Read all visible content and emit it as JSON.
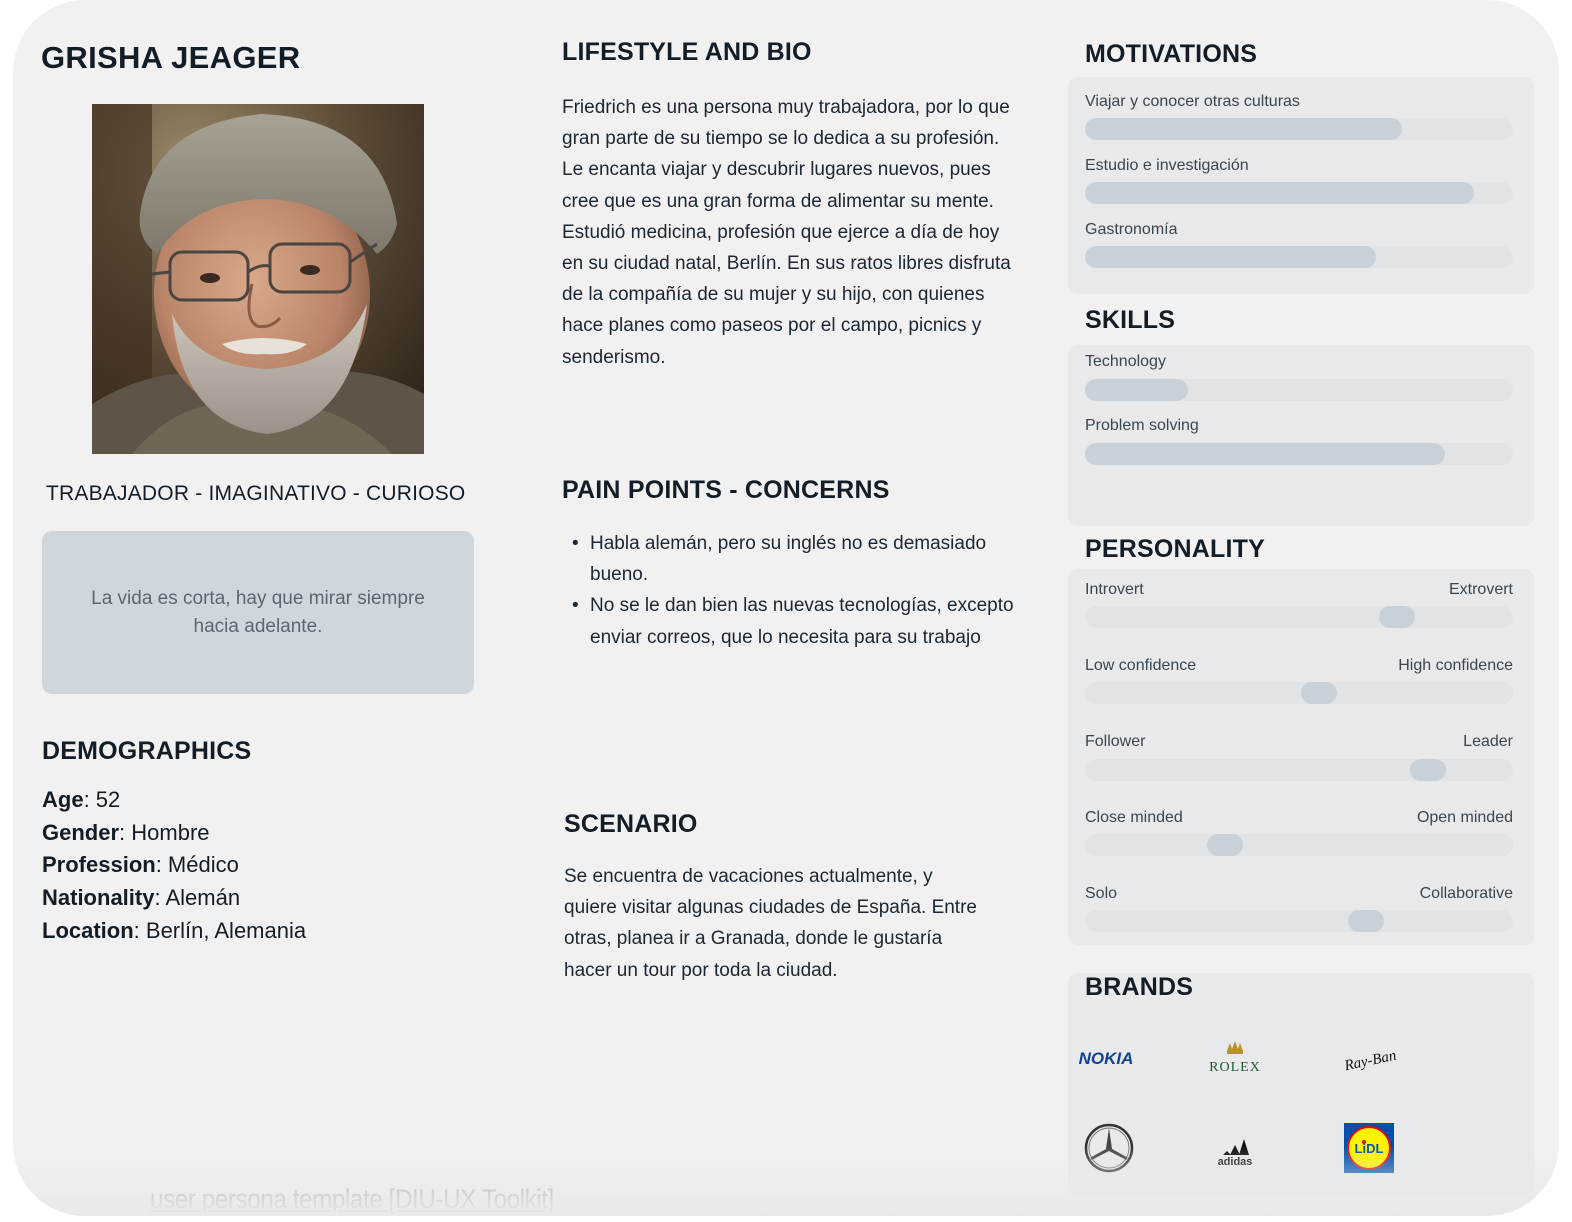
{
  "persona": {
    "name": "GRISHA JEAGER",
    "traits": "TRABAJADOR - IMAGINATIVO - CURIOSO",
    "quote": "La vida es corta, hay que mirar siempre hacia adelante."
  },
  "demographics": {
    "heading": "DEMOGRAPHICS",
    "items": [
      {
        "key": "Age",
        "value": ": 52"
      },
      {
        "key": "Gender",
        "value": ": Hombre"
      },
      {
        "key": "Profession",
        "value": ": Médico"
      },
      {
        "key": "Nationality",
        "value": ": Alemán"
      },
      {
        "key": "Location",
        "value": ": Berlín, Alemania"
      }
    ]
  },
  "bio": {
    "heading": "LIFESTYLE AND BIO",
    "lines": [
      "Friedrich es una persona muy trabajadora, por lo que",
      "gran parte de su tiempo se lo dedica a su profesión.",
      "Le encanta viajar y descubrir lugares nuevos, pues",
      "cree que es una gran forma de alimentar su mente.",
      "Estudió medicina, profesión que ejerce a día de hoy",
      "en su ciudad natal, Berlín. En sus ratos libres disfruta",
      "de la compañía de su mujer y su hijo, con quienes",
      "hace planes como paseos por el campo, picnics y",
      "senderismo."
    ]
  },
  "pains": {
    "heading": "PAIN POINTS - CONCERNS",
    "items": [
      "Habla alemán, pero su inglés no es demasiado bueno.",
      "No se le dan bien las nuevas tecnologías, excepto enviar correos, que lo necesita para su trabajo"
    ]
  },
  "scenario": {
    "heading": "SCENARIO",
    "lines": [
      "Se encuentra de vacaciones actualmente, y",
      "quiere visitar algunas ciudades de España. Entre",
      "otras, planea ir a Granada, donde le gustaría",
      "hacer un tour por toda la ciudad."
    ]
  },
  "motivations": {
    "heading": "MOTIVATIONS",
    "items": [
      {
        "label": "Viajar y conocer otras culturas",
        "level": 0.74
      },
      {
        "label": "Estudio e investigación",
        "level": 0.91
      },
      {
        "label": "Gastronomía",
        "level": 0.68
      }
    ]
  },
  "skills": {
    "heading": "SKILLS",
    "items": [
      {
        "label": "Technology",
        "level": 0.24
      },
      {
        "label": "Problem solving",
        "level": 0.84
      }
    ]
  },
  "personality": {
    "heading": "PERSONALITY",
    "items": [
      {
        "left": "Introvert",
        "right": "Extrovert",
        "position": 0.75
      },
      {
        "left": "Low confidence",
        "right": "High confidence",
        "position": 0.55
      },
      {
        "left": "Follower",
        "right": "Leader",
        "position": 0.83
      },
      {
        "left": "Close minded",
        "right": "Open minded",
        "position": 0.31
      },
      {
        "left": "Solo",
        "right": "Collaborative",
        "position": 0.67
      }
    ]
  },
  "brands": {
    "heading": "BRANDS",
    "logos": [
      {
        "name": "nokia-logo",
        "text": "NOKIA",
        "color": "#124191"
      },
      {
        "name": "rolex-logo",
        "text": "ROLEX",
        "color": "#1f5a36"
      },
      {
        "name": "ray-ban-logo",
        "text": "Ray-Ban",
        "color": "#111111"
      },
      {
        "name": "mercedes-logo",
        "text": "",
        "color": "#333333"
      },
      {
        "name": "adidas-logo",
        "text": "adidas",
        "color": "#111111"
      },
      {
        "name": "lidl-logo",
        "text": "LiDL",
        "color": "#0050aa"
      }
    ]
  },
  "footer": {
    "link_text": "user persona template [DIU-UX Toolkit]"
  }
}
